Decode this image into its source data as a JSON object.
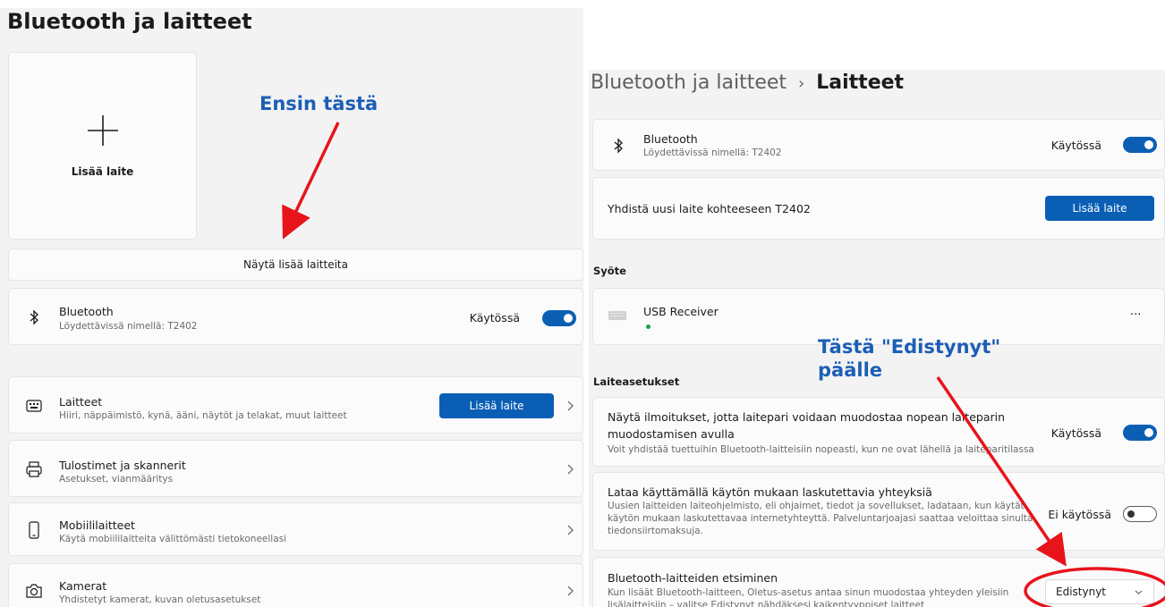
{
  "left": {
    "page_title": "Bluetooth ja laitteet",
    "add_device_tile_label": "Lisää laite",
    "show_more_devices": "Näytä lisää laitteita",
    "annotation": "Ensin tästä",
    "bluetooth": {
      "title": "Bluetooth",
      "subtitle": "Löydettävissä nimellä: T2402",
      "status": "Käytössä"
    },
    "rows": [
      {
        "title": "Laitteet",
        "subtitle": "Hiiri, näppäimistö, kynä, ääni, näytöt ja telakat, muut laitteet",
        "button": "Lisää laite"
      },
      {
        "title": "Tulostimet ja skannerit",
        "subtitle": "Asetukset, vianmääritys"
      },
      {
        "title": "Mobiililaitteet",
        "subtitle": "Käytä mobiililaitteita välittömästi tietokoneellasi"
      },
      {
        "title": "Kamerat",
        "subtitle": "Yhdistetyt kamerat, kuvan oletusasetukset"
      }
    ]
  },
  "right": {
    "breadcrumb_parent": "Bluetooth ja laitteet",
    "breadcrumb_separator": "›",
    "breadcrumb_current": "Laitteet",
    "bluetooth": {
      "title": "Bluetooth",
      "subtitle": "Löydettävissä nimellä: T2402",
      "status": "Käytössä"
    },
    "connect_new": {
      "title": "Yhdistä uusi laite kohteeseen T2402",
      "button": "Lisää laite"
    },
    "input_section": "Syöte",
    "usb_receiver": {
      "title": "USB Receiver",
      "more": "···"
    },
    "settings_section": "Laiteasetukset",
    "annotation_line1": "Tästä \"Edistynyt\"",
    "annotation_line2": "päälle",
    "swift_pair": {
      "title": "Näytä ilmoitukset, jotta laitepari voidaan muodostaa nopean laiteparin muodostamisen avulla",
      "subtitle": "Voit yhdistää tuettuihin Bluetooth-laitteisiin nopeasti, kun ne ovat lähellä ja laiteparitilassa",
      "status": "Käytössä"
    },
    "metered": {
      "title": "Lataa käyttämällä käytön mukaan laskutettavia yhteyksiä",
      "subtitle": "Uusien laitteiden laiteohjelmisto, eli ohjaimet, tiedot ja sovellukset, ladataan, kun käytät käytön mukaan laskutettavaa internetyhteyttä. Palveluntarjoajasi saattaa veloittaa sinulta tiedonsiirtomaksuja.",
      "status": "Ei käytössä"
    },
    "discovery": {
      "title": "Bluetooth-laitteiden etsiminen",
      "subtitle": "Kun lisäät Bluetooth-laitteen, Oletus-asetus antaa sinun muodostaa yhteyden yleisiin lisälaitteisiin – valitse Edistynyt nähdäksesi kaikentyyppiset laitteet",
      "selected": "Edistynyt"
    }
  },
  "colors": {
    "accent": "#0a5fb5",
    "annotation_text": "#1c5eb5",
    "annotation_red": "#e8141c"
  }
}
